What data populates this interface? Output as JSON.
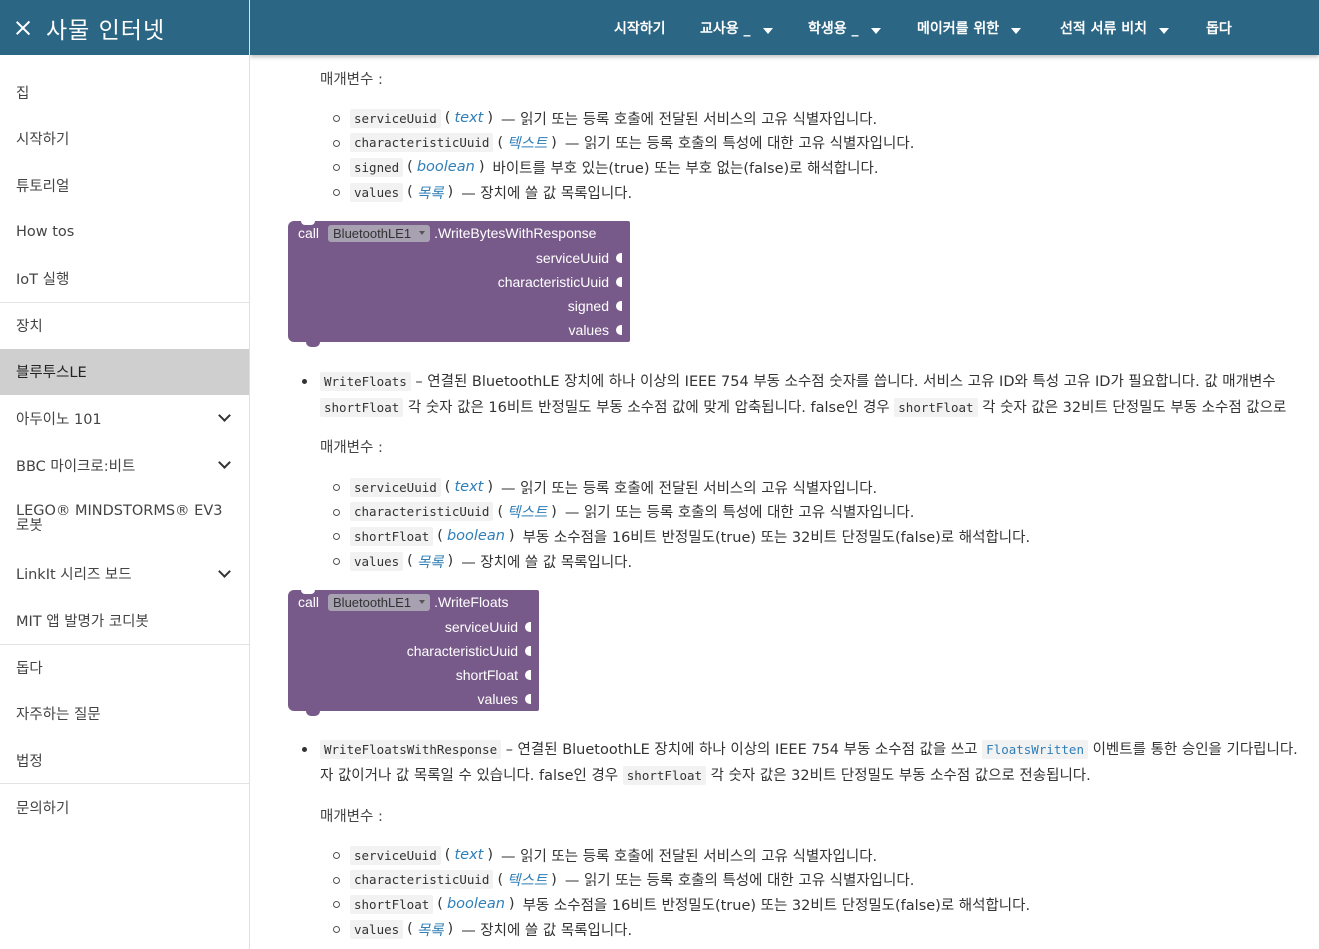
{
  "sidebar": {
    "title": "사물 인터넷",
    "items": [
      {
        "label": "집"
      },
      {
        "label": "시작하기"
      },
      {
        "label": "튜토리얼"
      },
      {
        "label": "How tos"
      },
      {
        "label": "IoT 실행"
      },
      {
        "label": "장치"
      },
      {
        "label": "블루투스LE"
      },
      {
        "label": "아두이노 101"
      },
      {
        "label": "BBC 마이크로:비트"
      },
      {
        "label": "LEGO® MINDSTORMS® EV3 로봇"
      },
      {
        "label": "LinkIt 시리즈 보드"
      },
      {
        "label": "MIT 앱 발명가 코디봇"
      },
      {
        "label": "돕다"
      },
      {
        "label": "자주하는 질문"
      },
      {
        "label": "법정"
      },
      {
        "label": "문의하기"
      }
    ]
  },
  "topnav": {
    "start": "시작하기",
    "teachers": "교사용 _",
    "students": "학생용 _",
    "makers": "메이커를 위한",
    "docs": "선적 서류 비치",
    "help": "돕다"
  },
  "content": {
    "params_label": "매개변수 :",
    "s1": {
      "p1": {
        "code": "serviceUuid",
        "type": "text",
        "desc": "— 읽기 또는 등록 호출에 전달된 서비스의 고유 식별자입니다."
      },
      "p2": {
        "code": "characteristicUuid",
        "type": "텍스트",
        "desc": "— 읽기 또는 등록 호출의 특성에 대한 고유 식별자입니다."
      },
      "p3": {
        "code": "signed",
        "type": "boolean",
        "desc": "바이트를 부호 있는(true) 또는 부호 없는(false)로 해석합니다."
      },
      "p4": {
        "code": "values",
        "type": "목록",
        "desc": "— 장치에 쓸 값 목록입니다."
      }
    },
    "block1": {
      "call": "call",
      "component": "BluetoothLE1",
      "method": ".WriteBytesWithResponse",
      "sockets": [
        "serviceUuid",
        "characteristicUuid",
        "signed",
        "values"
      ]
    },
    "item2": {
      "code": "WriteFloats",
      "text1": "– 연결된 BluetoothLE 장치에 하나 이상의 IEEE 754 부동 소수점 숫자를 씁니다. 서비스 고유 ID와 특성 고유 ID가 필요합니다. 값 매개변수",
      "code2": "shortFloat",
      "text2": "각 숫자 값은 16비트 반정밀도 부동 소수점 값에 맞게 압축됩니다. false인 경우",
      "code3": "shortFloat",
      "text3": "각 숫자 값은 32비트 단정밀도 부동 소수점 값으로"
    },
    "s2": {
      "p1": {
        "code": "serviceUuid",
        "type": "text",
        "desc": "— 읽기 또는 등록 호출에 전달된 서비스의 고유 식별자입니다."
      },
      "p2": {
        "code": "characteristicUuid",
        "type": "텍스트",
        "desc": "— 읽기 또는 등록 호출의 특성에 대한 고유 식별자입니다."
      },
      "p3": {
        "code": "shortFloat",
        "type": "boolean",
        "desc": "부동 소수점을 16비트 반정밀도(true) 또는 32비트 단정밀도(false)로 해석합니다."
      },
      "p4": {
        "code": "values",
        "type": "목록",
        "desc": "— 장치에 쓸 값 목록입니다."
      }
    },
    "block2": {
      "call": "call",
      "component": "BluetoothLE1",
      "method": ".WriteFloats",
      "sockets": [
        "serviceUuid",
        "characteristicUuid",
        "shortFloat",
        "values"
      ]
    },
    "item3": {
      "code": "WriteFloatsWithResponse",
      "text1": "– 연결된 BluetoothLE 장치에 하나 이상의 IEEE 754 부동 소수점 값을 쓰고",
      "event": "FloatsWritten",
      "text1b": "이벤트를 통한 승인을 기다립니다.",
      "text2": "자 값이거나 값 목록일 수 있습니다. false인 경우",
      "code2": "shortFloat",
      "text3": "각 숫자 값은 32비트 단정밀도 부동 소수점 값으로 전송됩니다."
    },
    "s3": {
      "p1": {
        "code": "serviceUuid",
        "type": "text",
        "desc": "— 읽기 또는 등록 호출에 전달된 서비스의 고유 식별자입니다."
      },
      "p2": {
        "code": "characteristicUuid",
        "type": "텍스트",
        "desc": "— 읽기 또는 등록 호출의 특성에 대한 고유 식별자입니다."
      },
      "p3": {
        "code": "shortFloat",
        "type": "boolean",
        "desc": "부동 소수점을 16비트 반정밀도(true) 또는 32비트 단정밀도(false)로 해석합니다."
      },
      "p4": {
        "code": "values",
        "type": "목록",
        "desc": "— 장치에 쓸 값 목록입니다."
      }
    }
  },
  "colors": {
    "header": "#2b6684",
    "block": "#785a8a",
    "link": "#2f7fb8",
    "active_item": "#cfcfcf"
  },
  "icons": {
    "close": "close-icon",
    "chevron": "chevron-down-icon",
    "caret": "caret-down-icon"
  }
}
